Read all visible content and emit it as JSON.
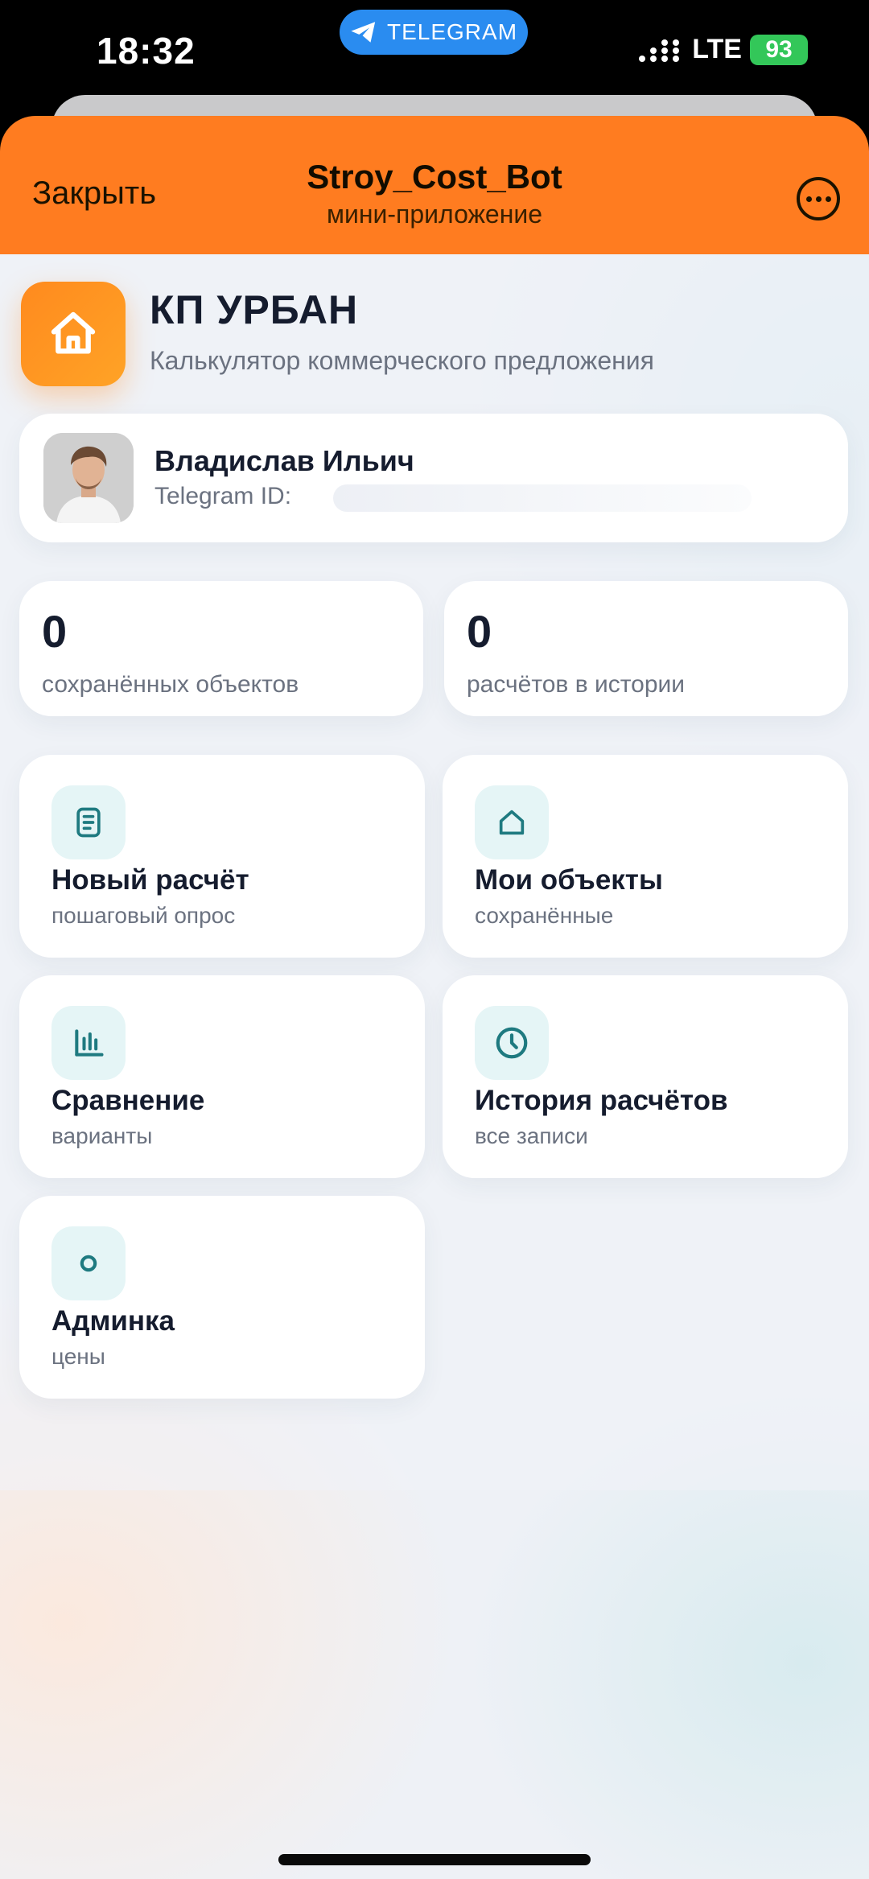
{
  "status_bar": {
    "time": "18:32",
    "pill_label": "TELEGRAM",
    "network": "LTE",
    "battery": "93"
  },
  "header": {
    "close_label": "Закрыть",
    "bot_name": "Stroy_Cost_Bot",
    "bot_subtitle": "мини-приложение"
  },
  "app": {
    "name": "КП УРБАН",
    "description": "Калькулятор коммерческого предложения"
  },
  "user": {
    "name": "Владислав Ильич",
    "id_label": "Telegram ID:"
  },
  "stats": [
    {
      "value": "0",
      "label": "сохранённых объектов"
    },
    {
      "value": "0",
      "label": "расчётов в истории"
    }
  ],
  "menu": [
    {
      "title": "Новый расчёт",
      "subtitle": "пошаговый опрос",
      "icon": "document-icon"
    },
    {
      "title": "Мои объекты",
      "subtitle": "сохранённые",
      "icon": "home-icon"
    },
    {
      "title": "Сравнение",
      "subtitle": "варианты",
      "icon": "bar-chart-icon"
    },
    {
      "title": "История расчётов",
      "subtitle": "все записи",
      "icon": "clock-icon"
    },
    {
      "title": "Админка",
      "subtitle": "цены",
      "icon": "circle-icon"
    }
  ],
  "colors": {
    "header_bg": "#ff7c20",
    "accent_teal": "#1e7a80",
    "icon_box_bg": "#e5f5f6",
    "battery_green": "#33c759",
    "telegram_blue": "#2a8cf0"
  }
}
